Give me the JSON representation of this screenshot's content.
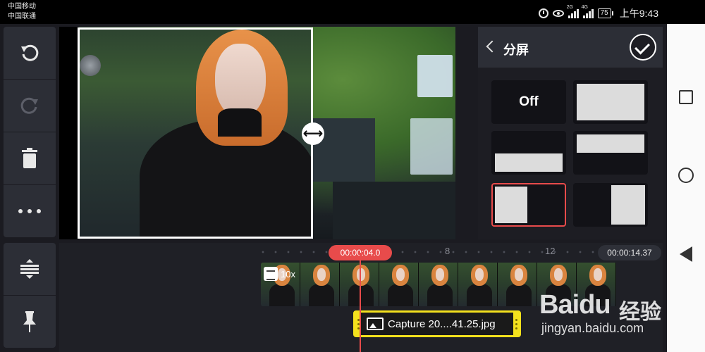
{
  "status_bar": {
    "carrier_1": "中国移动",
    "carrier_2": "中国联通",
    "signal_1_tag": "2G",
    "signal_2_tag": "4G",
    "battery": "75",
    "time": "上午9:43"
  },
  "toolbar": {
    "undo_icon": "undo-icon",
    "redo_icon": "redo-icon",
    "delete_icon": "trash-icon",
    "more_icon": "more-icon",
    "adjust_icon": "layer-adjust-icon",
    "pin_icon": "pin-icon"
  },
  "panel": {
    "title": "分屏",
    "options": [
      {
        "id": "off",
        "label": "Off"
      },
      {
        "id": "full"
      },
      {
        "id": "bottom"
      },
      {
        "id": "top"
      },
      {
        "id": "left",
        "selected": true
      },
      {
        "id": "right"
      }
    ]
  },
  "timeline": {
    "current_time": "00:00:04.0",
    "total_time": "00:00:14.37",
    "tick_8": "8",
    "tick_12": "12",
    "speed_label": "10x",
    "layer_clip_name": "Capture 20....41.25.jpg"
  },
  "watermark": {
    "logo": "Baidu",
    "cn": "经验",
    "url": "jingyan.baidu.com"
  },
  "colors": {
    "accent_red": "#e84b4b",
    "clip_yellow": "#f3e11d",
    "panel_bg": "#2c2e36"
  }
}
